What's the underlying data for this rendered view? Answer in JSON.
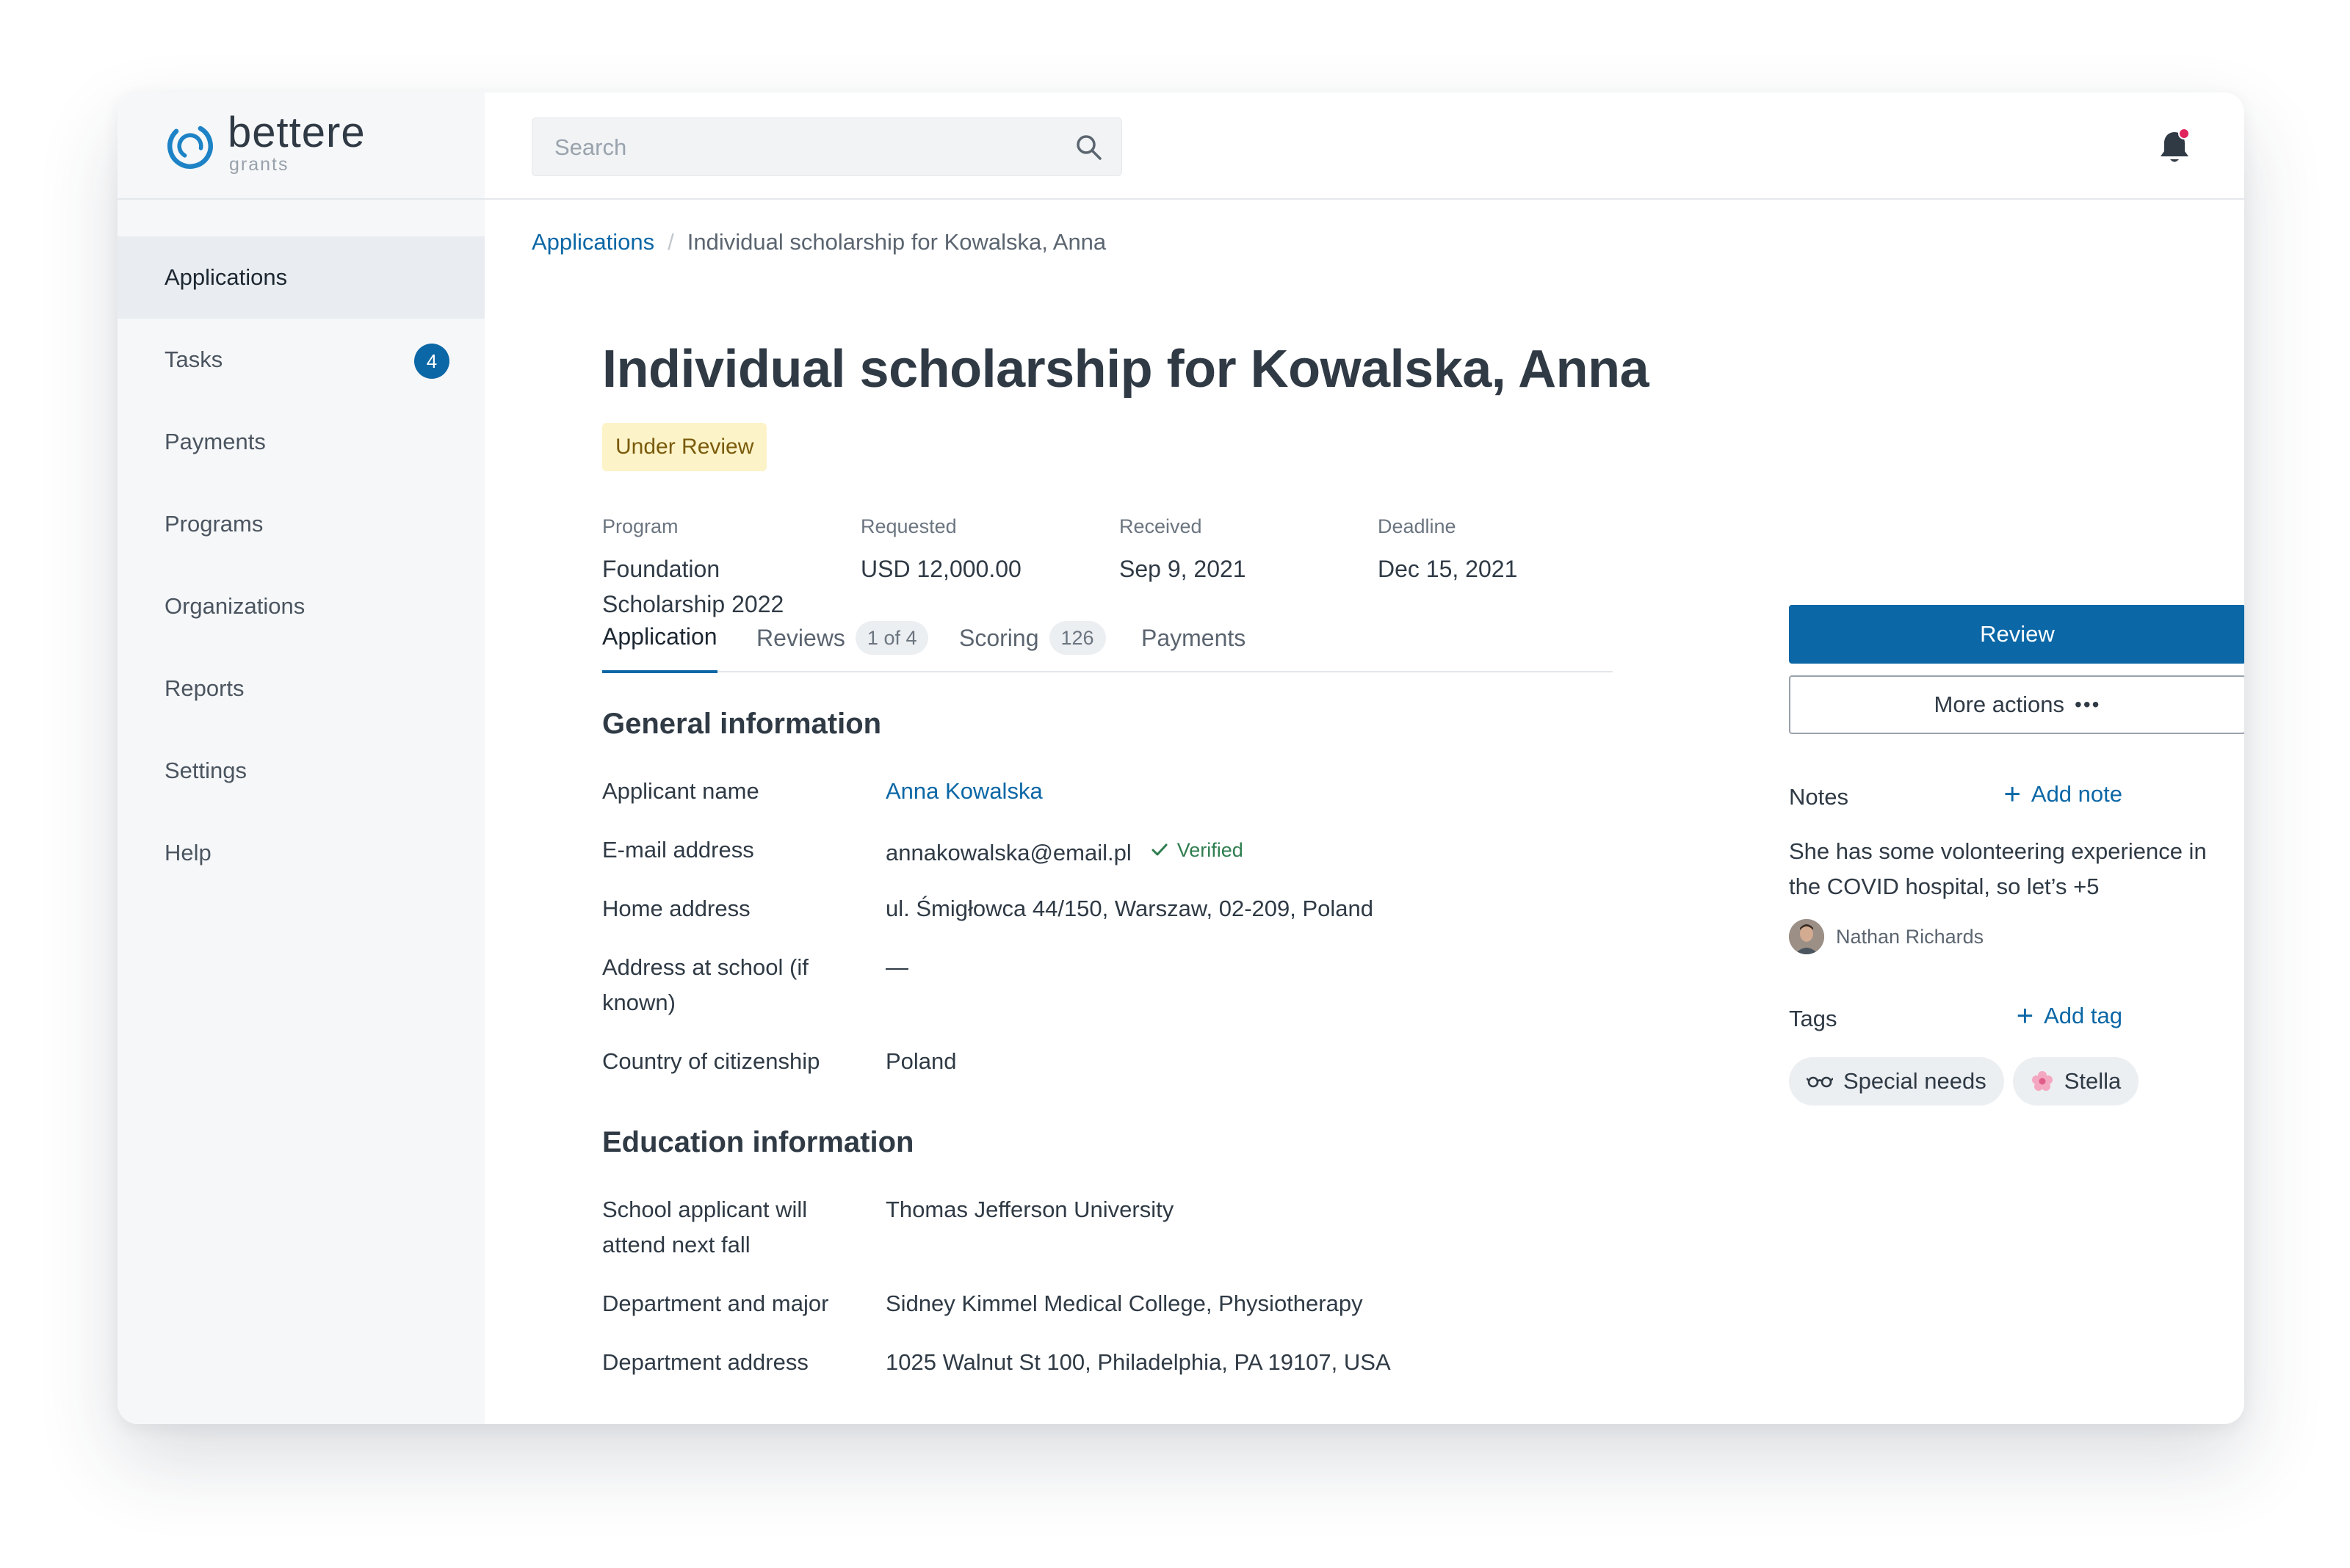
{
  "brand": {
    "name": "bettere",
    "subtitle": "grants"
  },
  "sidebar": {
    "items": [
      {
        "label": "Applications",
        "active": true
      },
      {
        "label": "Tasks",
        "badge": "4"
      },
      {
        "label": "Payments"
      },
      {
        "label": "Programs"
      },
      {
        "label": "Organizations"
      },
      {
        "label": "Reports"
      },
      {
        "label": "Settings"
      },
      {
        "label": "Help"
      }
    ]
  },
  "topbar": {
    "search": {
      "placeholder": "Search",
      "value": ""
    },
    "notification": {
      "has_unread": true,
      "dot_color": "#e0245e"
    }
  },
  "breadcrumb": {
    "parent": "Applications",
    "separator": "/",
    "current": "Individual scholarship for Kowalska, Anna"
  },
  "application": {
    "title": "Individual scholarship for Kowalska, Anna",
    "status": "Under Review",
    "meta": {
      "program": {
        "label": "Program",
        "value_line1": "Foundation",
        "value_line2": "Scholarship 2022"
      },
      "requested": {
        "label": "Requested",
        "value": "USD 12,000.00"
      },
      "received": {
        "label": "Received",
        "value": "Sep 9, 2021"
      },
      "deadline": {
        "label": "Deadline",
        "value": "Dec 15, 2021"
      }
    }
  },
  "tabs": [
    {
      "label": "Application",
      "active": true
    },
    {
      "label": "Reviews",
      "count": "1 of 4"
    },
    {
      "label": "Scoring",
      "count": "126"
    },
    {
      "label": "Payments"
    }
  ],
  "general": {
    "title": "General information",
    "applicant_name": {
      "label": "Applicant name",
      "value": "Anna Kowalska"
    },
    "email": {
      "label": "E-mail address",
      "value": "annakowalska@email.pl",
      "verified": "Verified"
    },
    "home_address": {
      "label": "Home address",
      "value": "ul. Śmigłowca 44/150, Warszaw, 02-209, Poland"
    },
    "school_address": {
      "label_line1": "Address at school (if",
      "label_line2": "known)",
      "value": "—"
    },
    "citizenship": {
      "label": "Country of citizenship",
      "value": "Poland"
    }
  },
  "education": {
    "title": "Education information",
    "school": {
      "label_line1": "School applicant will",
      "label_line2": "attend next fall",
      "value": "Thomas Jefferson University"
    },
    "department": {
      "label": "Department and major",
      "value": "Sidney Kimmel Medical College, Physiotherapy"
    },
    "department_address": {
      "label": "Department address",
      "value": "1025 Walnut St 100, Philadelphia, PA 19107, USA"
    }
  },
  "actions": {
    "review": "Review",
    "more": "More actions",
    "more_icon": "ellipsis-icon"
  },
  "notes": {
    "title": "Notes",
    "add": "Add note",
    "text_line1": "She has some volonteering experience in",
    "text_line2": "the COVID hospital, so let’s +5",
    "author": "Nathan Richards"
  },
  "tags": {
    "title": "Tags",
    "add": "Add tag",
    "items": [
      {
        "label": "Special needs",
        "icon": "glasses-icon"
      },
      {
        "label": "Stella",
        "icon": "flower-icon"
      }
    ]
  },
  "colors": {
    "accent": "#0b67a6",
    "status_bg": "#fdf3c8",
    "status_text": "#7a5b0c",
    "verified": "#2e7d4f",
    "sidebar_bg": "#f6f7f9"
  }
}
